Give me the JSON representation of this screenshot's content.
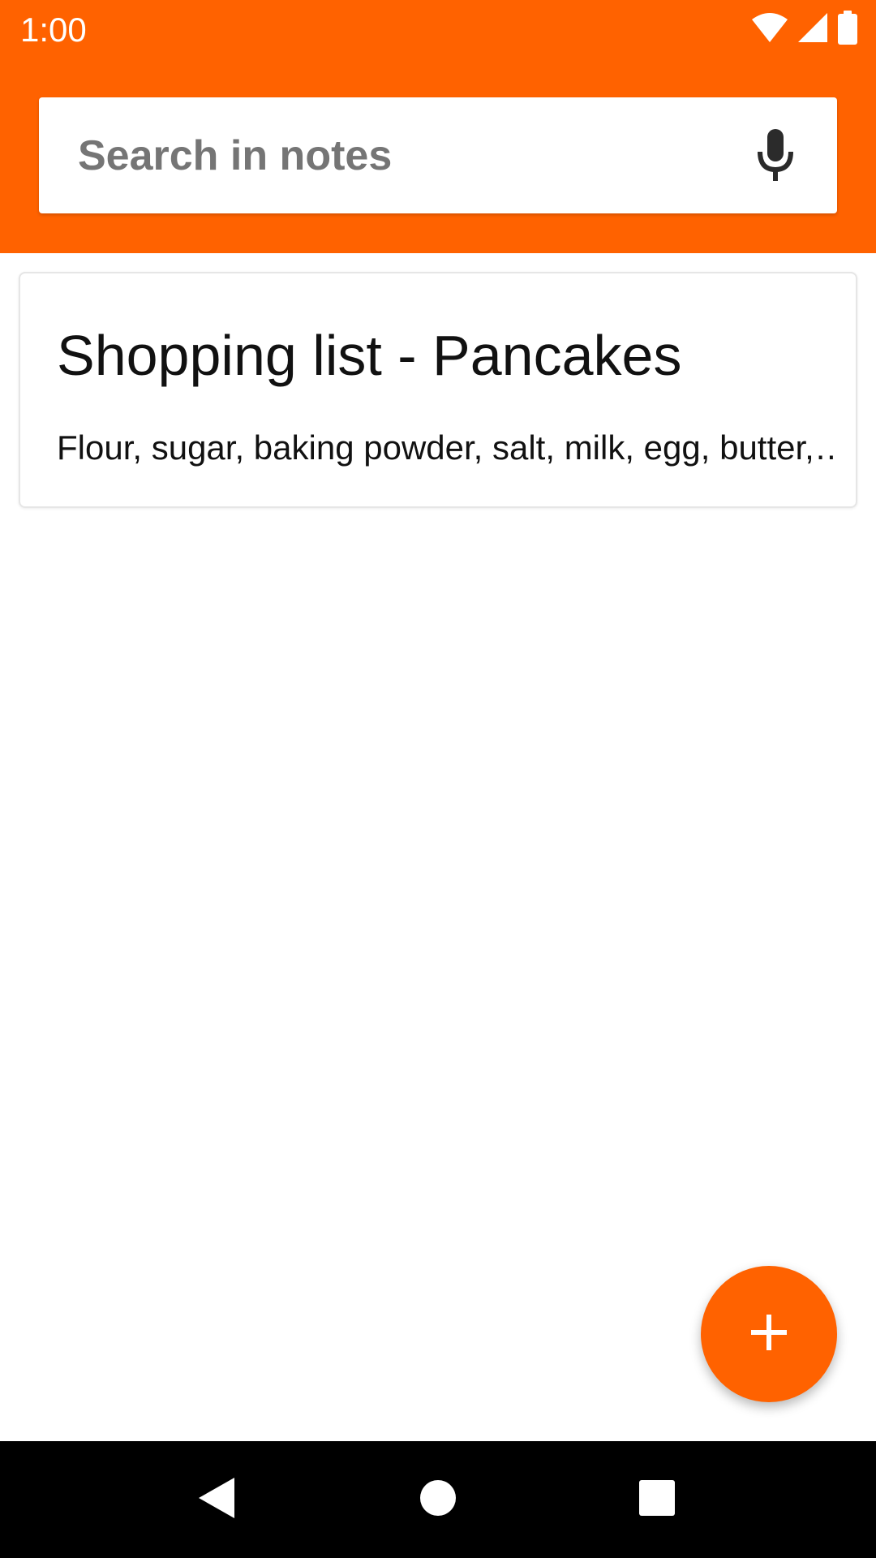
{
  "status_bar": {
    "time": "1:00",
    "icons": [
      "wifi-icon",
      "cellular-signal-icon",
      "battery-icon"
    ]
  },
  "search": {
    "placeholder": "Search in notes",
    "value": "",
    "mic_icon": "microphone-icon"
  },
  "notes": [
    {
      "title": "Shopping list - Pancakes",
      "preview": "Flour, sugar, baking powder, salt, milk, egg, butter,…"
    }
  ],
  "fab": {
    "icon": "plus-icon"
  },
  "nav_bar": {
    "buttons": [
      "back-icon",
      "home-icon",
      "recents-icon"
    ]
  },
  "colors": {
    "accent": "#FF6200",
    "background": "#FFFFFF",
    "nav_bar": "#000000"
  }
}
